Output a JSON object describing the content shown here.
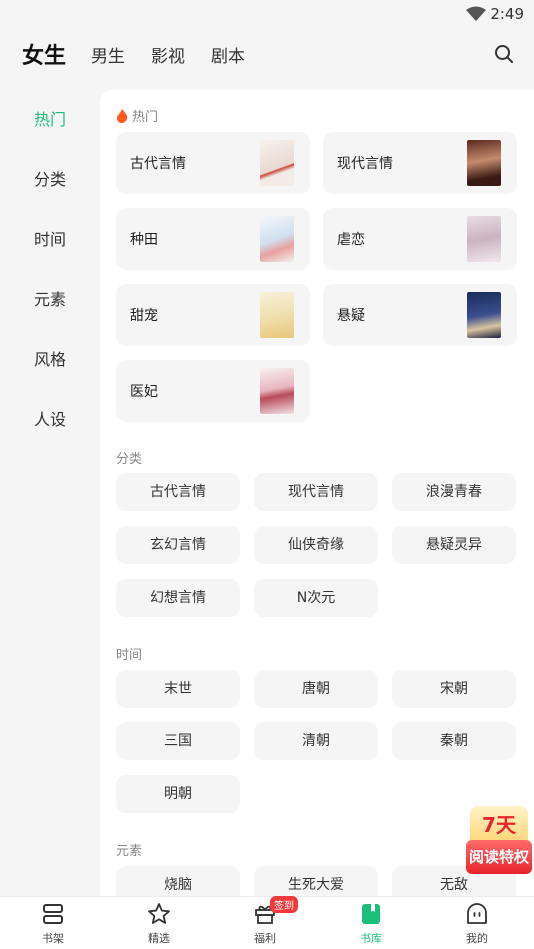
{
  "status": {
    "time": "2:49"
  },
  "topnav": {
    "tabs": [
      {
        "label": "女生",
        "active": true
      },
      {
        "label": "男生",
        "active": false
      },
      {
        "label": "影视",
        "active": false
      },
      {
        "label": "剧本",
        "active": false
      }
    ]
  },
  "sidebar": {
    "items": [
      {
        "label": "热门",
        "active": true
      },
      {
        "label": "分类"
      },
      {
        "label": "时间"
      },
      {
        "label": "元素"
      },
      {
        "label": "风格"
      },
      {
        "label": "人设"
      }
    ]
  },
  "sections": {
    "hot": {
      "title": "热门",
      "cards": [
        {
          "label": "古代言情"
        },
        {
          "label": "现代言情"
        },
        {
          "label": "种田"
        },
        {
          "label": "虐恋"
        },
        {
          "label": "甜宠"
        },
        {
          "label": "悬疑"
        },
        {
          "label": "医妃"
        }
      ]
    },
    "category": {
      "title": "分类",
      "chips": [
        "古代言情",
        "现代言情",
        "浪漫青春",
        "玄幻言情",
        "仙侠奇缘",
        "悬疑灵异",
        "幻想言情",
        "N次元"
      ]
    },
    "time": {
      "title": "时间",
      "chips": [
        "末世",
        "唐朝",
        "宋朝",
        "三国",
        "清朝",
        "秦朝",
        "明朝"
      ]
    },
    "element": {
      "title": "元素",
      "chips": [
        "烧脑",
        "生死大爱",
        "无敌"
      ]
    }
  },
  "promo": {
    "top": "7天",
    "bottom": "阅读特权"
  },
  "bottombar": {
    "items": [
      {
        "label": "书架",
        "icon": "bookshelf-icon"
      },
      {
        "label": "精选",
        "icon": "star-icon"
      },
      {
        "label": "福利",
        "icon": "gift-icon",
        "badge": "签到"
      },
      {
        "label": "书库",
        "icon": "library-icon",
        "active": true
      },
      {
        "label": "我的",
        "icon": "profile-icon"
      }
    ]
  },
  "colors": {
    "accent": "#1bbf7a",
    "badge": "#f23a3a"
  }
}
